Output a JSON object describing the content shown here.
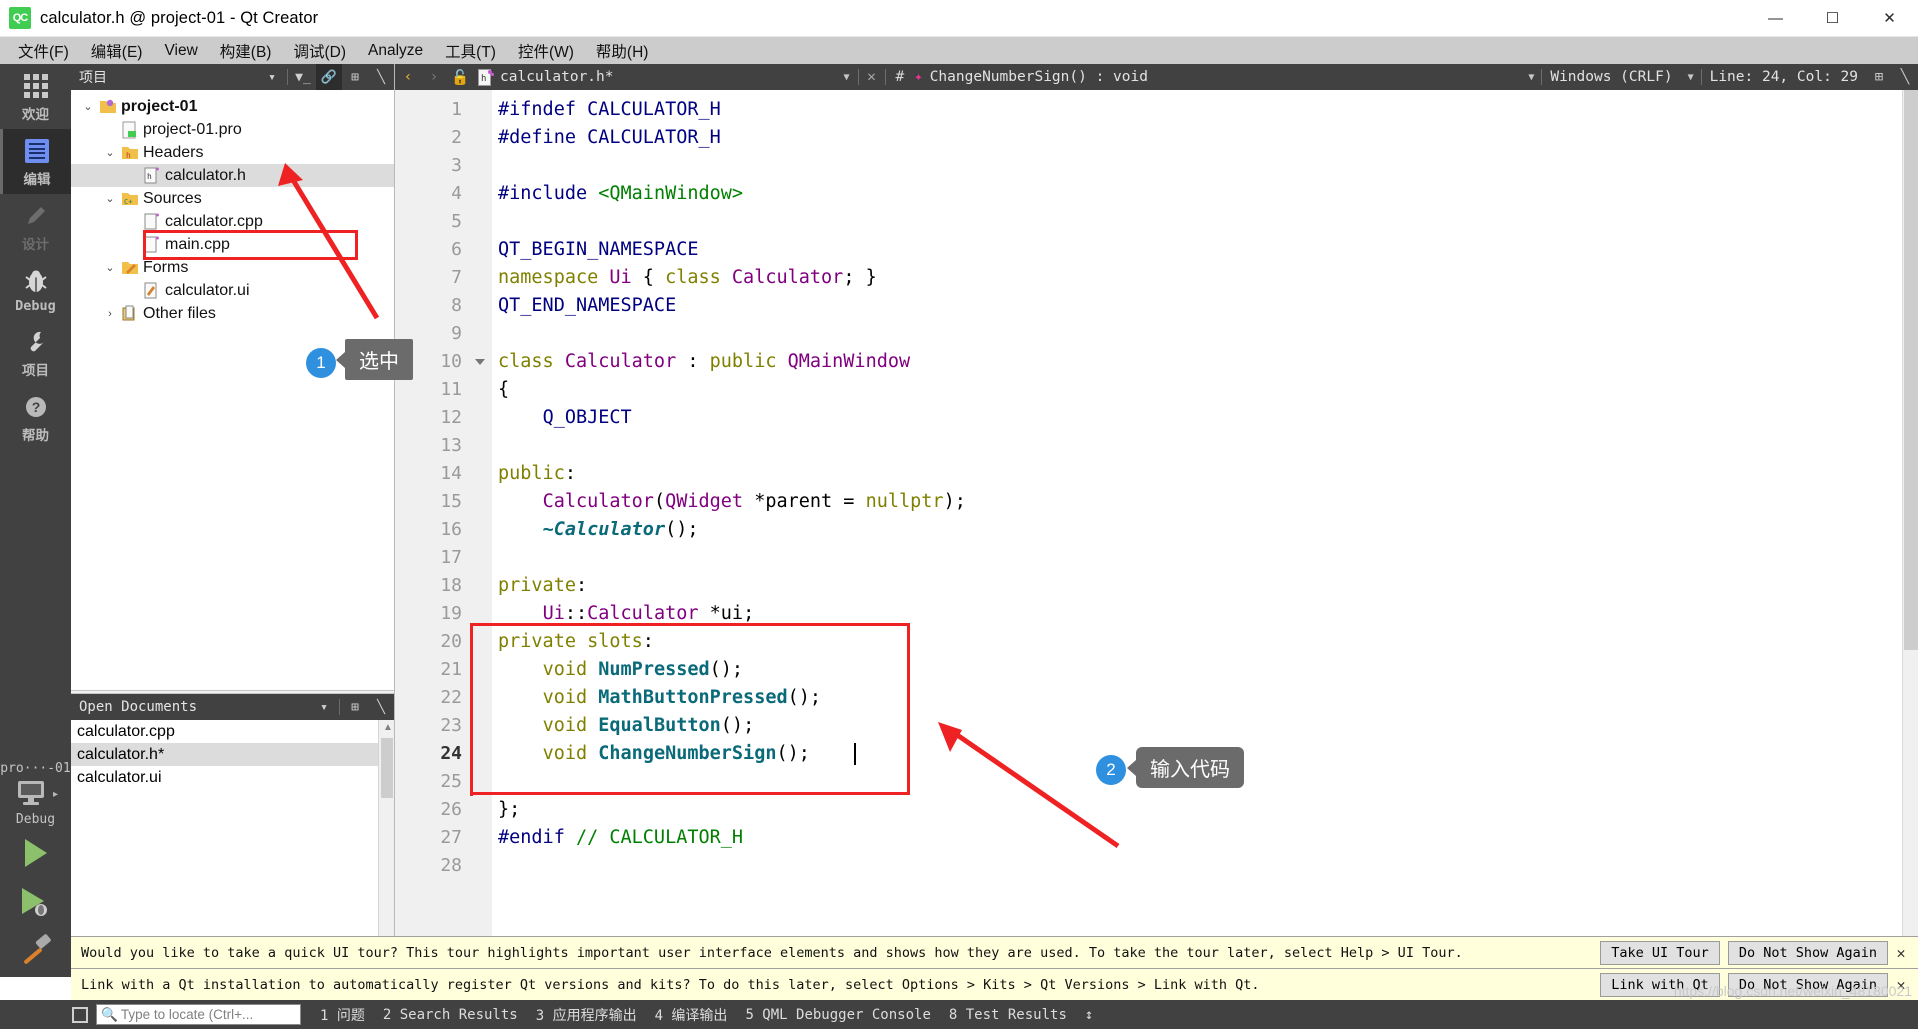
{
  "window": {
    "title": "calculator.h @ project-01 - Qt Creator",
    "app_icon": "qt-creator-icon",
    "minimize": "—",
    "maximize": "☐",
    "close": "✕"
  },
  "menubar": {
    "items": [
      {
        "label": "文件(F)",
        "name": "menu-file"
      },
      {
        "label": "编辑(E)",
        "name": "menu-edit"
      },
      {
        "label": "View",
        "name": "menu-view"
      },
      {
        "label": "构建(B)",
        "name": "menu-build"
      },
      {
        "label": "调试(D)",
        "name": "menu-debug"
      },
      {
        "label": "Analyze",
        "name": "menu-analyze"
      },
      {
        "label": "工具(T)",
        "name": "menu-tools"
      },
      {
        "label": "控件(W)",
        "name": "menu-widgets"
      },
      {
        "label": "帮助(H)",
        "name": "menu-help"
      }
    ]
  },
  "modebar": {
    "modes": [
      {
        "label": "欢迎",
        "icon": "grid-icon",
        "active": false,
        "dim": false
      },
      {
        "label": "编辑",
        "icon": "edit-icon",
        "active": true,
        "dim": false
      },
      {
        "label": "设计",
        "icon": "pencil-icon",
        "active": false,
        "dim": true
      },
      {
        "label": "Debug",
        "icon": "bug-icon",
        "active": false,
        "dim": false
      },
      {
        "label": "项目",
        "icon": "wrench-icon",
        "active": false,
        "dim": false
      },
      {
        "label": "帮助",
        "icon": "question-icon",
        "active": false,
        "dim": false
      }
    ],
    "kit_name": "pro···-01",
    "build_config": "Debug",
    "run_label": "run-button",
    "debug_label": "start-debugging-button",
    "build_label": "build-button"
  },
  "project_panel": {
    "title": "项目",
    "tools": [
      "filter-icon",
      "link-icon",
      "split-icon",
      "close-icon"
    ],
    "tree": [
      {
        "label": "project-01",
        "indent": 0,
        "arrow": "⌄",
        "icon": "project-icon",
        "bold": true,
        "selected": false
      },
      {
        "label": "project-01.pro",
        "indent": 1,
        "arrow": "",
        "icon": "pro-file-icon",
        "bold": false,
        "selected": false
      },
      {
        "label": "Headers",
        "indent": 1,
        "arrow": "⌄",
        "icon": "folder-h-icon",
        "bold": false,
        "selected": false
      },
      {
        "label": "calculator.h",
        "indent": 2,
        "arrow": "",
        "icon": "header-icon",
        "bold": false,
        "selected": true
      },
      {
        "label": "Sources",
        "indent": 1,
        "arrow": "⌄",
        "icon": "folder-c-icon",
        "bold": false,
        "selected": false
      },
      {
        "label": "calculator.cpp",
        "indent": 2,
        "arrow": "",
        "icon": "cpp-file-icon",
        "bold": false,
        "selected": false
      },
      {
        "label": "main.cpp",
        "indent": 2,
        "arrow": "",
        "icon": "cpp-file-icon",
        "bold": false,
        "selected": false
      },
      {
        "label": "Forms",
        "indent": 1,
        "arrow": "⌄",
        "icon": "folder-ui-icon",
        "bold": false,
        "selected": false
      },
      {
        "label": "calculator.ui",
        "indent": 2,
        "arrow": "",
        "icon": "ui-file-icon",
        "bold": false,
        "selected": false
      },
      {
        "label": "Other files",
        "indent": 1,
        "arrow": "›",
        "icon": "other-icon",
        "bold": false,
        "selected": false
      }
    ]
  },
  "open_documents": {
    "title": "Open Documents",
    "items": [
      {
        "label": "calculator.cpp",
        "selected": false
      },
      {
        "label": "calculator.h*",
        "selected": true
      },
      {
        "label": "calculator.ui",
        "selected": false
      }
    ]
  },
  "editor_toolbar": {
    "back": "‹",
    "forward": "›",
    "lock": "unlock-icon",
    "file_icon": "header-file-icon",
    "filename": "calculator.h*",
    "close": "✕",
    "hash": "#",
    "symbol": "ChangeNumberSign() : void",
    "line_ending": "Windows (CRLF)",
    "cursor_position": "Line: 24, Col: 29",
    "split_icon": "split-editor-icon"
  },
  "code": {
    "total_lines": 28,
    "current_line": 24,
    "lines": [
      {
        "n": 1,
        "tokens": [
          {
            "t": "#ifndef ",
            "c": "pp"
          },
          {
            "t": "CALCULATOR_H",
            "c": "pp"
          }
        ]
      },
      {
        "n": 2,
        "tokens": [
          {
            "t": "#define ",
            "c": "pp"
          },
          {
            "t": "CALCULATOR_H",
            "c": "pp"
          }
        ]
      },
      {
        "n": 3,
        "tokens": []
      },
      {
        "n": 4,
        "tokens": [
          {
            "t": "#include ",
            "c": "pp"
          },
          {
            "t": "<QMainWindow>",
            "c": "str"
          }
        ]
      },
      {
        "n": 5,
        "tokens": []
      },
      {
        "n": 6,
        "tokens": [
          {
            "t": "QT_BEGIN_NAMESPACE",
            "c": "pp"
          }
        ]
      },
      {
        "n": 7,
        "tokens": [
          {
            "t": "namespace ",
            "c": "kw"
          },
          {
            "t": "Ui",
            "c": "typ"
          },
          {
            "t": " { ",
            "c": "pl"
          },
          {
            "t": "class ",
            "c": "kw"
          },
          {
            "t": "Calculator",
            "c": "typ"
          },
          {
            "t": "; }",
            "c": "pl"
          }
        ]
      },
      {
        "n": 8,
        "tokens": [
          {
            "t": "QT_END_NAMESPACE",
            "c": "pp"
          }
        ]
      },
      {
        "n": 9,
        "tokens": []
      },
      {
        "n": 10,
        "tokens": [
          {
            "t": "class ",
            "c": "kw"
          },
          {
            "t": "Calculator",
            "c": "typ"
          },
          {
            "t": " : ",
            "c": "pl"
          },
          {
            "t": "public ",
            "c": "kw"
          },
          {
            "t": "QMainWindow",
            "c": "typ"
          }
        ],
        "fold": true
      },
      {
        "n": 11,
        "tokens": [
          {
            "t": "{",
            "c": "pl"
          }
        ]
      },
      {
        "n": 12,
        "tokens": [
          {
            "t": "    ",
            "c": "pl"
          },
          {
            "t": "Q_OBJECT",
            "c": "pp"
          }
        ]
      },
      {
        "n": 13,
        "tokens": []
      },
      {
        "n": 14,
        "tokens": [
          {
            "t": "public",
            "c": "kw"
          },
          {
            "t": ":",
            "c": "pl"
          }
        ]
      },
      {
        "n": 15,
        "tokens": [
          {
            "t": "    ",
            "c": "pl"
          },
          {
            "t": "Calculator",
            "c": "typ"
          },
          {
            "t": "(",
            "c": "pl"
          },
          {
            "t": "QWidget",
            "c": "typ"
          },
          {
            "t": " *parent = ",
            "c": "pl"
          },
          {
            "t": "nullptr",
            "c": "kw"
          },
          {
            "t": ");",
            "c": "pl"
          }
        ]
      },
      {
        "n": 16,
        "tokens": [
          {
            "t": "    ",
            "c": "pl"
          },
          {
            "t": "~Calculator",
            "c": "dtor"
          },
          {
            "t": "();",
            "c": "pl"
          }
        ]
      },
      {
        "n": 17,
        "tokens": []
      },
      {
        "n": 18,
        "tokens": [
          {
            "t": "private",
            "c": "kw"
          },
          {
            "t": ":",
            "c": "pl"
          }
        ]
      },
      {
        "n": 19,
        "tokens": [
          {
            "t": "    ",
            "c": "pl"
          },
          {
            "t": "Ui",
            "c": "typ"
          },
          {
            "t": "::",
            "c": "pl"
          },
          {
            "t": "Calculator",
            "c": "typ"
          },
          {
            "t": " *ui;",
            "c": "pl"
          }
        ]
      },
      {
        "n": 20,
        "tokens": [
          {
            "t": "private slots",
            "c": "kw"
          },
          {
            "t": ":",
            "c": "pl"
          }
        ]
      },
      {
        "n": 21,
        "tokens": [
          {
            "t": "    ",
            "c": "pl"
          },
          {
            "t": "void ",
            "c": "kw"
          },
          {
            "t": "NumPressed",
            "c": "fn"
          },
          {
            "t": "();",
            "c": "pl"
          }
        ]
      },
      {
        "n": 22,
        "tokens": [
          {
            "t": "    ",
            "c": "pl"
          },
          {
            "t": "void ",
            "c": "kw"
          },
          {
            "t": "MathButtonPressed",
            "c": "fn"
          },
          {
            "t": "();",
            "c": "pl"
          }
        ]
      },
      {
        "n": 23,
        "tokens": [
          {
            "t": "    ",
            "c": "pl"
          },
          {
            "t": "void ",
            "c": "kw"
          },
          {
            "t": "EqualButton",
            "c": "fn"
          },
          {
            "t": "();",
            "c": "pl"
          }
        ]
      },
      {
        "n": 24,
        "tokens": [
          {
            "t": "    ",
            "c": "pl"
          },
          {
            "t": "void ",
            "c": "kw"
          },
          {
            "t": "ChangeNumberSign",
            "c": "fn"
          },
          {
            "t": "();",
            "c": "pl"
          }
        ]
      },
      {
        "n": 25,
        "tokens": []
      },
      {
        "n": 26,
        "tokens": [
          {
            "t": "};",
            "c": "pl"
          }
        ]
      },
      {
        "n": 27,
        "tokens": [
          {
            "t": "#endif ",
            "c": "pp"
          },
          {
            "t": "// CALCULATOR_H",
            "c": "cm"
          }
        ]
      },
      {
        "n": 28,
        "tokens": []
      }
    ]
  },
  "annotations": [
    {
      "number": "1",
      "label": "选中"
    },
    {
      "number": "2",
      "label": "输入代码"
    }
  ],
  "infobars": [
    {
      "text": "Would you like to take a quick UI tour? This tour highlights important user interface elements and shows how they are used. To take the tour later, select Help > UI Tour.",
      "primary": "Take UI Tour",
      "secondary": "Do Not Show Again",
      "close": "✕"
    },
    {
      "text": "Link with a Qt installation to automatically register Qt versions and kits? To do this later, select Options > Kits > Qt Versions > Link with Qt.",
      "primary": "Link with Qt",
      "secondary": "Do Not Show Again",
      "close": "✕"
    }
  ],
  "statusbar": {
    "sidebar_toggle": "sidebar-toggle-icon",
    "locate_placeholder": "Type to locate (Ctrl+...",
    "panes": [
      "1 问题",
      "2 Search Results",
      "3 应用程序输出",
      "4 编译输出",
      "5 QML Debugger Console",
      "8 Test Results"
    ],
    "expand": "↕"
  },
  "watermark": "https://blog.csdn.net/weixin_48180021",
  "colors": {
    "accent_blue": "#2f90e0",
    "annotation_red": "#ee2222",
    "qt_green": "#41cd52",
    "dark_chrome": "#414141"
  }
}
